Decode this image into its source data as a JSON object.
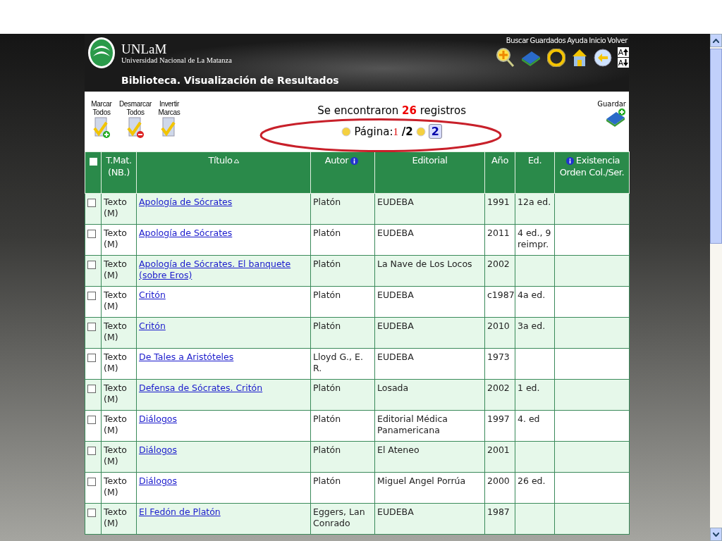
{
  "brand": {
    "name": "UNLaM",
    "subtitle": "Universidad Nacional de La Matanza"
  },
  "page_title": "Biblioteca. Visualización de Resultados",
  "nav": [
    {
      "label": "Buscar",
      "kind": "search"
    },
    {
      "label": "Guardados",
      "kind": "books"
    },
    {
      "label": "Ayuda",
      "kind": "help"
    },
    {
      "label": "Inicio",
      "kind": "home"
    },
    {
      "label": "Volver",
      "kind": "back"
    }
  ],
  "font_buttons": [
    {
      "label": "A",
      "kind": "up"
    },
    {
      "label": "A",
      "kind": "down"
    }
  ],
  "mark_actions": [
    {
      "label": "Marcar Todos",
      "kind": "add"
    },
    {
      "label": "Desmarcar Todos",
      "kind": "remove"
    },
    {
      "label": "Invertir Marcas",
      "kind": "invert"
    }
  ],
  "results": {
    "prefix": "Se encontraron",
    "count": "26",
    "suffix": "registros",
    "page_label": "Página:",
    "current_page": "1",
    "total": "/2",
    "next_page": "2"
  },
  "save": {
    "label": "Guardar"
  },
  "table": {
    "all_checked": false,
    "columns": [
      {
        "label": "T.Mat. (NB.)",
        "kind": "plain"
      },
      {
        "label": "Título",
        "kind": "sort"
      },
      {
        "label": "Autor",
        "kind": "info-after"
      },
      {
        "label": "Editorial",
        "kind": "plain"
      },
      {
        "label": "Año",
        "kind": "plain"
      },
      {
        "label": "Ed.",
        "kind": "plain"
      },
      {
        "label": "Existencia Orden Col./Ser.",
        "kind": "info-before"
      }
    ],
    "rows": [
      {
        "checked": false,
        "type": "Texto (M)",
        "title": "Apología de Sócrates",
        "author": "Platón",
        "publisher": "EUDEBA",
        "year": "1991",
        "edition": "12a ed."
      },
      {
        "checked": false,
        "type": "Texto (M)",
        "title": "Apología de Sócrates",
        "author": "Platón",
        "publisher": "EUDEBA",
        "year": "2011",
        "edition": "4 ed., 9 reimpr."
      },
      {
        "checked": false,
        "type": "Texto (M)",
        "title": "Apología de Sócrates. El banquete (sobre Eros)",
        "author": "Platón",
        "publisher": "La Nave de Los Locos",
        "year": "2002",
        "edition": ""
      },
      {
        "checked": false,
        "type": "Texto (M)",
        "title": "Critón",
        "author": "Platón",
        "publisher": "EUDEBA",
        "year": "c1987",
        "edition": "4a ed."
      },
      {
        "checked": false,
        "type": "Texto (M)",
        "title": "Critón",
        "author": "Platón",
        "publisher": "EUDEBA",
        "year": "2010",
        "edition": "3a ed."
      },
      {
        "checked": false,
        "type": "Texto (M)",
        "title": "De Tales a Aristóteles",
        "author": "Lloyd G., E. R.",
        "publisher": "EUDEBA",
        "year": "1973",
        "edition": ""
      },
      {
        "checked": false,
        "type": "Texto (M)",
        "title": "Defensa de Sócrates. Critón",
        "author": "Platón",
        "publisher": "Losada",
        "year": "2002",
        "edition": "1 ed."
      },
      {
        "checked": false,
        "type": "Texto (M)",
        "title": "Diálogos",
        "author": "Platón",
        "publisher": "Editorial Médica Panamericana",
        "year": "1997",
        "edition": "4. ed"
      },
      {
        "checked": false,
        "type": "Texto (M)",
        "title": "Diálogos",
        "author": "Platón",
        "publisher": "El Ateneo",
        "year": "2001",
        "edition": ""
      },
      {
        "checked": false,
        "type": "Texto (M)",
        "title": "Diálogos",
        "author": "Platón",
        "publisher": "Miguel Angel Porrúa",
        "year": "2000",
        "edition": "26 ed."
      },
      {
        "checked": false,
        "type": "Texto (M)",
        "title": "El Fedón de Platón",
        "author": "Eggers, Lan Conrado",
        "publisher": "EUDEBA",
        "year": "1987",
        "edition": ""
      }
    ]
  }
}
